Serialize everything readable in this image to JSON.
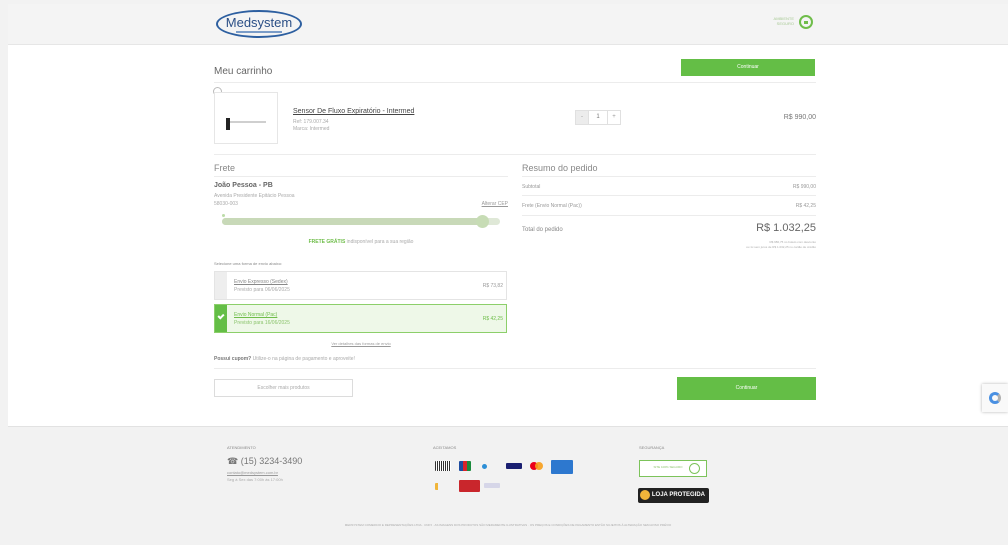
{
  "header": {
    "logo": "Medsystem",
    "secure_label": "AMBIENTE SEGURO"
  },
  "cart": {
    "title": "Meu carrinho",
    "continue_label": "Continuar",
    "product": {
      "name": "Sensor De Fluxo Expiratório - Intermed",
      "ref": "Ref: 179.007.34",
      "brand": "Marca: Intermed",
      "qty": "1",
      "minus": "-",
      "plus": "+",
      "price": "R$ 990,00"
    }
  },
  "frete": {
    "title": "Frete",
    "name": "João Pessoa - PB",
    "address": "Avenida Presidente Epitácio Pessoa",
    "cep": "58030-003",
    "alterar": "Alterar CEP",
    "progress": 0.95,
    "free_bold": "FRETE GRÁTIS",
    "free_rest": "indisponível para a sua região",
    "choose": "Selecione uma forma de envio abaixo:",
    "options": [
      {
        "name": "Envio Expresso (Sedex)",
        "date": "Previsto para 06/06/2025",
        "price": "R$ 73,82",
        "selected": false
      },
      {
        "name": "Envio Normal (Pac)",
        "date": "Previsto para 16/06/2025",
        "price": "R$ 42,25",
        "selected": true
      }
    ],
    "ver_detalhes": "Ver detalhes das formas de envio",
    "cupom_bold": "Possui cupom?",
    "cupom_rest": "Utilize-o na página de pagamento e aproveite!"
  },
  "summary": {
    "title": "Resumo do pedido",
    "subtotal_label": "Subtotal",
    "subtotal_value": "R$ 990,00",
    "frete_label": "Frete (Envio Normal (Pac))",
    "frete_value": "R$ 42,25",
    "total_label": "Total do pedido",
    "total_value": "R$ 1.032,25",
    "note1": "R$ 980,75 no boleto com desconto",
    "note2": "ou 1x sem juros de R$ 1.032,25 no cartão de crédito"
  },
  "actions": {
    "more_label": "Escolher mais produtos",
    "continue_label": "Continuar"
  },
  "footer": {
    "atend_head": "ATENDIMENTO",
    "phone": "☎ (15) 3234-3490",
    "email": "contato@medsystem.com.br",
    "hours": "Seg à Sex das 7:00h às 17:00h",
    "aceitamos_head": "ACEITAMOS",
    "payments": [
      "boleto",
      "jcb",
      "dinners",
      "visa",
      "mastercard",
      "amex",
      "elo",
      "hipercard",
      "pix"
    ],
    "seg_head": "SEGURANÇA",
    "seg_badge": "SITE 100% SEGURO",
    "loja": "LOJA PROTEGIDA",
    "legal": "MEDSYSTEM COMERCIO E REPRESENTAÇÕES LTDA · CNPJ · AS IMAGENS DOS PRODUTOS SÃO MERAMENTE ILUSTRATIVAS · OS PREÇOS E CONDIÇÕES DE PAGAMENTO ESTÃO SUJEITOS À ALTERAÇÃO SEM AVISO PRÉVIO"
  },
  "colors": {
    "green": "#64be46",
    "logo_blue": "#2d5fa0"
  }
}
